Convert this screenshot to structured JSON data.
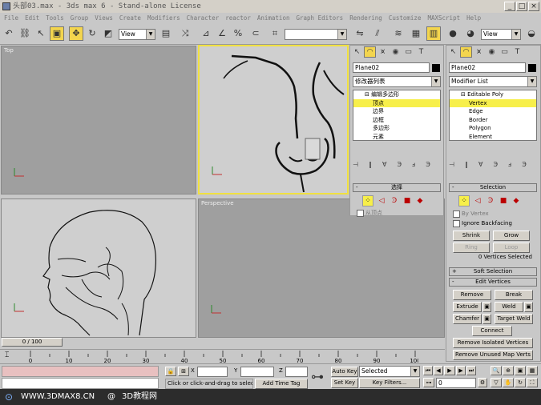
{
  "window": {
    "title": "头部03.max - 3ds max 6 - Stand-alone License",
    "minimize": "_",
    "maximize": "□",
    "close": "×"
  },
  "menu": [
    "File",
    "Edit",
    "Tools",
    "Group",
    "Views",
    "Create",
    "Modifiers",
    "Character",
    "reactor",
    "Animation",
    "Graph Editors",
    "Rendering",
    "Customize",
    "MAXScript",
    "Help"
  ],
  "toolbar": {
    "view_combo_left": "View",
    "view_combo_right": "View"
  },
  "viewports": {
    "top": "Top",
    "perspective": "Perspective"
  },
  "cn_panel": {
    "object_name": "Plane02",
    "modifier_list": "修改器列表",
    "stack": [
      "编辑多边形",
      "顶点",
      "边界",
      "边框",
      "多边形",
      "元素"
    ],
    "selected_index": 1,
    "rollout_selection": "选择",
    "by_vertex": "从顶点"
  },
  "en_panel": {
    "object_name": "Plane02",
    "modifier_list": "Modifier List",
    "stack": [
      "Editable Poly",
      "Vertex",
      "Edge",
      "Border",
      "Polygon",
      "Element"
    ],
    "selected_index": 1,
    "rollout_selection": "Selection",
    "by_vertex": "By Vertex",
    "ignore_backfacing": "Ignore Backfacing",
    "shrink": "Shrink",
    "grow": "Grow",
    "ring": "Ring",
    "loop": "Loop",
    "vertices_selected": "0 Vertices Selected",
    "soft_selection": "Soft Selection",
    "edit_vertices": "Edit Vertices",
    "remove": "Remove",
    "break": "Break",
    "extrude": "Extrude",
    "weld": "Weld",
    "chamfer": "Chamfer",
    "target_weld": "Target Weld",
    "connect": "Connect",
    "remove_isolated": "Remove Isolated Vertices",
    "remove_unused": "Remove Unused Map Verts"
  },
  "timeline": {
    "frame": "0 / 100"
  },
  "ruler_ticks": [
    "0",
    "10",
    "20",
    "30",
    "40",
    "50",
    "60",
    "70",
    "80",
    "90",
    "100"
  ],
  "status": {
    "x_label": "X",
    "y_label": "Y",
    "z_label": "Z",
    "prompt": "Click or click-and-drag to select ob",
    "add_time_tag": "Add Time Tag",
    "auto_key": "Auto Key",
    "selected": "Selected",
    "set_key": "Set Key",
    "key_filters": "Key Filters...",
    "frame_value": "0"
  },
  "footer": {
    "site": "WWW.3DMAX8.CN",
    "brand": "3D教程网",
    "copyright": "@"
  }
}
